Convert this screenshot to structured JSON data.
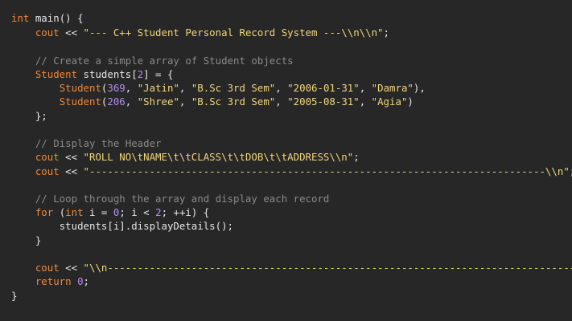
{
  "code": {
    "line_1": {
      "kw_int": "int",
      "rest": " main() {"
    },
    "line_2": {
      "indent": "    ",
      "cout": "cout",
      "op": " << ",
      "str": "\"--- C++ Student Personal Record System ---\\\\n\\\\n\"",
      "end": ";"
    },
    "line_4": {
      "indent": "    ",
      "comment": "// Create a simple array of Student objects"
    },
    "line_5": {
      "indent": "    ",
      "type": "Student",
      "mid": " students[",
      "num": "2",
      "end": "] = {"
    },
    "line_6": {
      "indent": "        ",
      "ctor": "Student",
      "p1": "(",
      "n1": "369",
      "c1": ", ",
      "s1": "\"Jatin\"",
      "c2": ", ",
      "s2": "\"B.Sc 3rd Sem\"",
      "c3": ", ",
      "s3": "\"2006-01-31\"",
      "c4": ", ",
      "s4": "\"Damra\"",
      "end": "),"
    },
    "line_7": {
      "indent": "        ",
      "ctor": "Student",
      "p1": "(",
      "n1": "206",
      "c1": ", ",
      "s1": "\"Shree\"",
      "c2": ", ",
      "s2": "\"B.Sc 3rd Sem\"",
      "c3": ", ",
      "s3": "\"2005-08-31\"",
      "c4": ", ",
      "s4": "\"Agia\"",
      "end": ")"
    },
    "line_8": {
      "indent": "    ",
      "text": "};"
    },
    "line_10": {
      "indent": "    ",
      "comment": "// Display the Header"
    },
    "line_11": {
      "indent": "    ",
      "cout": "cout",
      "op": " << ",
      "str": "\"ROLL NO\\tNAME\\t\\tCLASS\\t\\tDOB\\t\\tADDRESS\\\\n\"",
      "end": ";"
    },
    "line_12": {
      "indent": "    ",
      "cout": "cout",
      "op": " << ",
      "str": "\"----------------------------------------------------------------------------\\\\n\"",
      "end": ";"
    },
    "line_14": {
      "indent": "    ",
      "comment": "// Loop through the array and display each record"
    },
    "line_15": {
      "indent": "    ",
      "kw_for": "for",
      "p1": " (",
      "kw_int": "int",
      "mid1": " i = ",
      "n1": "0",
      "mid2": "; i < ",
      "n2": "2",
      "end": "; ++i) {"
    },
    "line_16": {
      "indent": "        ",
      "text": "students[i].displayDetails();"
    },
    "line_17": {
      "indent": "    ",
      "text": "}"
    },
    "line_19": {
      "indent": "    ",
      "cout": "cout",
      "op": " << ",
      "str": "\"\\\\n------------------------------------------------------------------------------\\\\n\"",
      "end": ";"
    },
    "line_20": {
      "indent": "    ",
      "kw_return": "return",
      "sp": " ",
      "n1": "0",
      "end": ";"
    },
    "line_21": {
      "text": "}"
    }
  },
  "colors": {
    "background": "#272727",
    "keyword": "#f0883a",
    "string": "#f1d67a",
    "number": "#b18ef0",
    "comment": "#8a8a8a",
    "plain": "#e6e6e6"
  }
}
